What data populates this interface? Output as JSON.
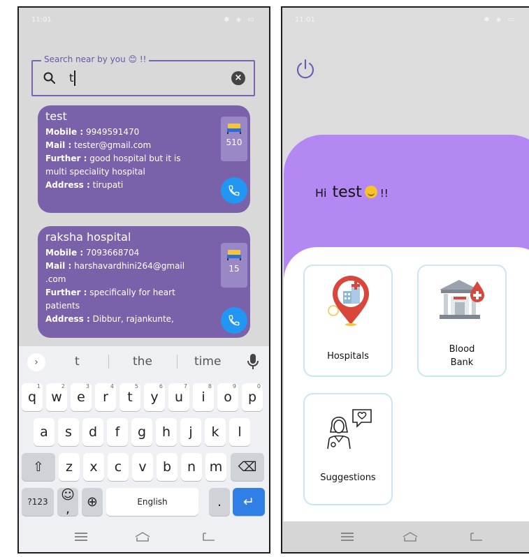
{
  "left_screen": {
    "status_bar": {
      "time": "11:01",
      "right_icons": "✱ ◈ ▭"
    },
    "search": {
      "legend": "Search near by you 😊 !!",
      "value": "t"
    },
    "results": [
      {
        "name": "test",
        "mobile_label": "Mobile :",
        "mobile": "9949591470",
        "mail_label": "Mail :",
        "mail": "tester@gmail.com",
        "further_label": "Further :",
        "further_1": "good hospital but it is",
        "further_2": "multi speciality hospital",
        "address_label": "Address :",
        "address": "tirupati",
        "beds": "510"
      },
      {
        "name": "raksha hospital",
        "mobile_label": "Mobile :",
        "mobile": "7093668704",
        "mail_label": "Mail :",
        "mail_1": "harshavardhini264@gmail",
        "mail_2": ".com",
        "further_label": "Further :",
        "further_1": "specifically for heart",
        "further_2": "patients",
        "address_label": "Address :",
        "address": "Dibbur, rajankunte,",
        "beds": "15"
      }
    ],
    "keyboard": {
      "suggestions": [
        "t",
        "the",
        "time"
      ],
      "row1": [
        {
          "k": "q",
          "h": "1"
        },
        {
          "k": "w",
          "h": "2"
        },
        {
          "k": "e",
          "h": "3"
        },
        {
          "k": "r",
          "h": "4"
        },
        {
          "k": "t",
          "h": "5"
        },
        {
          "k": "y",
          "h": "6"
        },
        {
          "k": "u",
          "h": "7"
        },
        {
          "k": "i",
          "h": "8"
        },
        {
          "k": "o",
          "h": "9"
        },
        {
          "k": "p",
          "h": "0"
        }
      ],
      "row2": [
        "a",
        "s",
        "d",
        "f",
        "g",
        "h",
        "j",
        "k",
        "l"
      ],
      "row3": [
        "z",
        "x",
        "c",
        "v",
        "b",
        "n",
        "m"
      ],
      "mode_key": "?123",
      "emoji_key": "☺",
      "comma": ",",
      "globe": "⊕",
      "space": "English",
      "period": ".",
      "enter": "↵",
      "shift": "⇧",
      "backspace": "⌫"
    }
  },
  "right_screen": {
    "status_bar": {
      "time": "11:01",
      "right_icons": "✱ ◈ ▭"
    },
    "greeting": {
      "hi": "Hi",
      "name": "test",
      "suffix": "!!"
    },
    "tiles": [
      {
        "label": "Hospitals"
      },
      {
        "label": "Blood\nBank"
      },
      {
        "label": "Suggestions"
      }
    ]
  },
  "colors": {
    "card_purple": "#7962a9",
    "header_purple": "#b388f2",
    "call_blue": "#2196f3",
    "tile_border": "#c9e6f3"
  }
}
